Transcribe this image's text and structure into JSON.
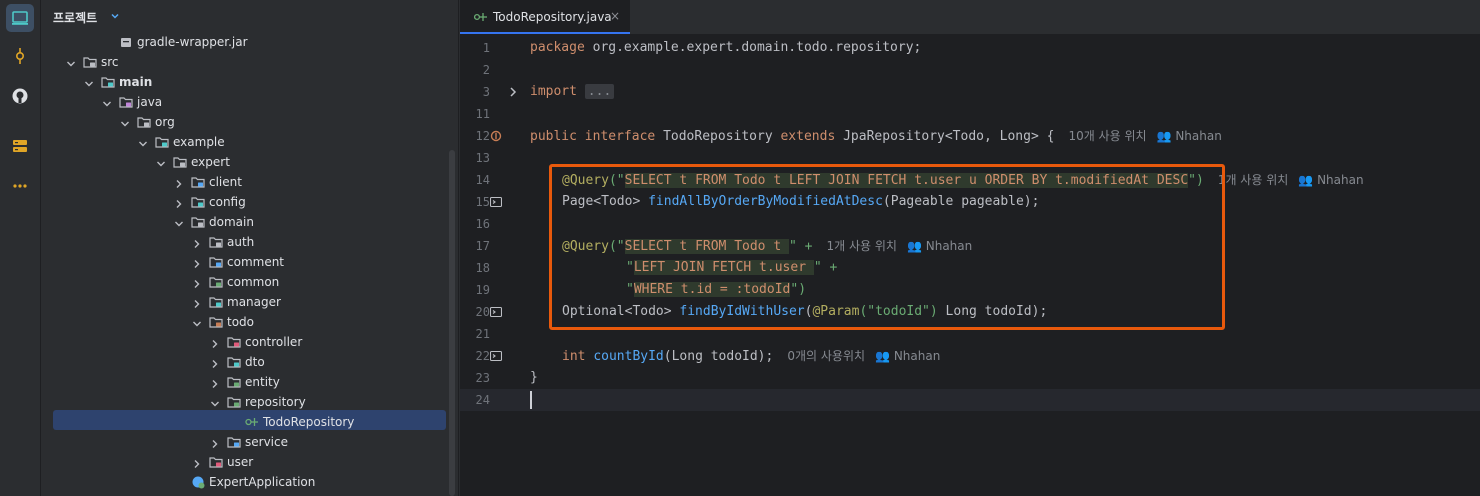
{
  "project_panel": {
    "title": "프로젝트",
    "tree": [
      {
        "label": "gradle-wrapper.jar",
        "icon": "jar-icon"
      },
      {
        "label": "src",
        "icon": "folder-icon"
      },
      {
        "label": "main",
        "icon": "source-folder-icon"
      },
      {
        "label": "java",
        "icon": "java-folder-icon"
      },
      {
        "label": "org",
        "icon": "package-icon"
      },
      {
        "label": "example",
        "icon": "package-icon"
      },
      {
        "label": "expert",
        "icon": "package-icon"
      },
      {
        "label": "client",
        "icon": "package-icon"
      },
      {
        "label": "config",
        "icon": "package-icon"
      },
      {
        "label": "domain",
        "icon": "package-icon"
      },
      {
        "label": "auth",
        "icon": "package-icon"
      },
      {
        "label": "comment",
        "icon": "package-icon"
      },
      {
        "label": "common",
        "icon": "package-icon"
      },
      {
        "label": "manager",
        "icon": "package-icon"
      },
      {
        "label": "todo",
        "icon": "package-icon"
      },
      {
        "label": "controller",
        "icon": "package-icon"
      },
      {
        "label": "dto",
        "icon": "package-icon"
      },
      {
        "label": "entity",
        "icon": "package-icon"
      },
      {
        "label": "repository",
        "icon": "package-icon"
      },
      {
        "label": "TodoRepository",
        "icon": "interface-icon"
      },
      {
        "label": "service",
        "icon": "package-icon"
      },
      {
        "label": "user",
        "icon": "package-icon"
      },
      {
        "label": "ExpertApplication",
        "icon": "spring-class-icon"
      }
    ]
  },
  "editor": {
    "tab_label": "TodoRepository.java",
    "tab_close": "×",
    "line_numbers": [
      "1",
      "2",
      "3",
      "11",
      "12",
      "13",
      "14",
      "15",
      "16",
      "17",
      "18",
      "19",
      "20",
      "21",
      "22",
      "23",
      "24"
    ],
    "lines": {
      "l1_package": "package",
      "l1_rest": " org.example.expert.domain.todo.repository;",
      "l3_import": "import",
      "l3_fold": "...",
      "l12_public": "public",
      "l12_interface": "interface",
      "l12_name": "TodoRepository",
      "l12_extends": "extends",
      "l12_type": "JpaRepository<Todo, Long>",
      "l12_brace": " {",
      "l12_usage": "10개 사용 위치",
      "l12_author": "Nhahan",
      "l14_ann": "@Query",
      "l14_open": "(\"",
      "l14_sql": "SELECT t FROM Todo t LEFT JOIN FETCH t.user u ORDER BY t.modifiedAt DESC",
      "l14_close": "\")",
      "l14_usage": "1개 사용 위치",
      "l14_author": "Nhahan",
      "l15_type": "Page<Todo>",
      "l15_fn": "findAllByOrderByModifiedAtDesc",
      "l15_params": "(Pageable pageable);",
      "l17_ann": "@Query",
      "l17_open": "(\"",
      "l17_sql": "SELECT t FROM Todo t ",
      "l17_close": "\" +",
      "l17_usage": "1개 사용 위치",
      "l17_author": "Nhahan",
      "l18_open": "\"",
      "l18_sql": "LEFT JOIN FETCH t.user ",
      "l18_close": "\" +",
      "l19_open": "\"",
      "l19_sql": "WHERE t.id = :todoId",
      "l19_close": "\")",
      "l20_type": "Optional<Todo>",
      "l20_fn": "findByIdWithUser",
      "l20_params_a": "(",
      "l20_param_ann": "@Param",
      "l20_param_str": "(\"todoId\")",
      "l20_params_b": " Long todoId);",
      "l22_int": "int",
      "l22_fn": "countById",
      "l22_params": "(Long todoId);",
      "l22_usage": "0개의 사용위치",
      "l22_author": "Nhahan",
      "l23_brace": "}"
    }
  },
  "colors": {
    "accent": "#3574f0",
    "highlight_box": "#e8590c",
    "keyword": "#cf8e6d",
    "annotation": "#b3ae60",
    "string": "#6aab73",
    "function": "#56a8f5"
  }
}
